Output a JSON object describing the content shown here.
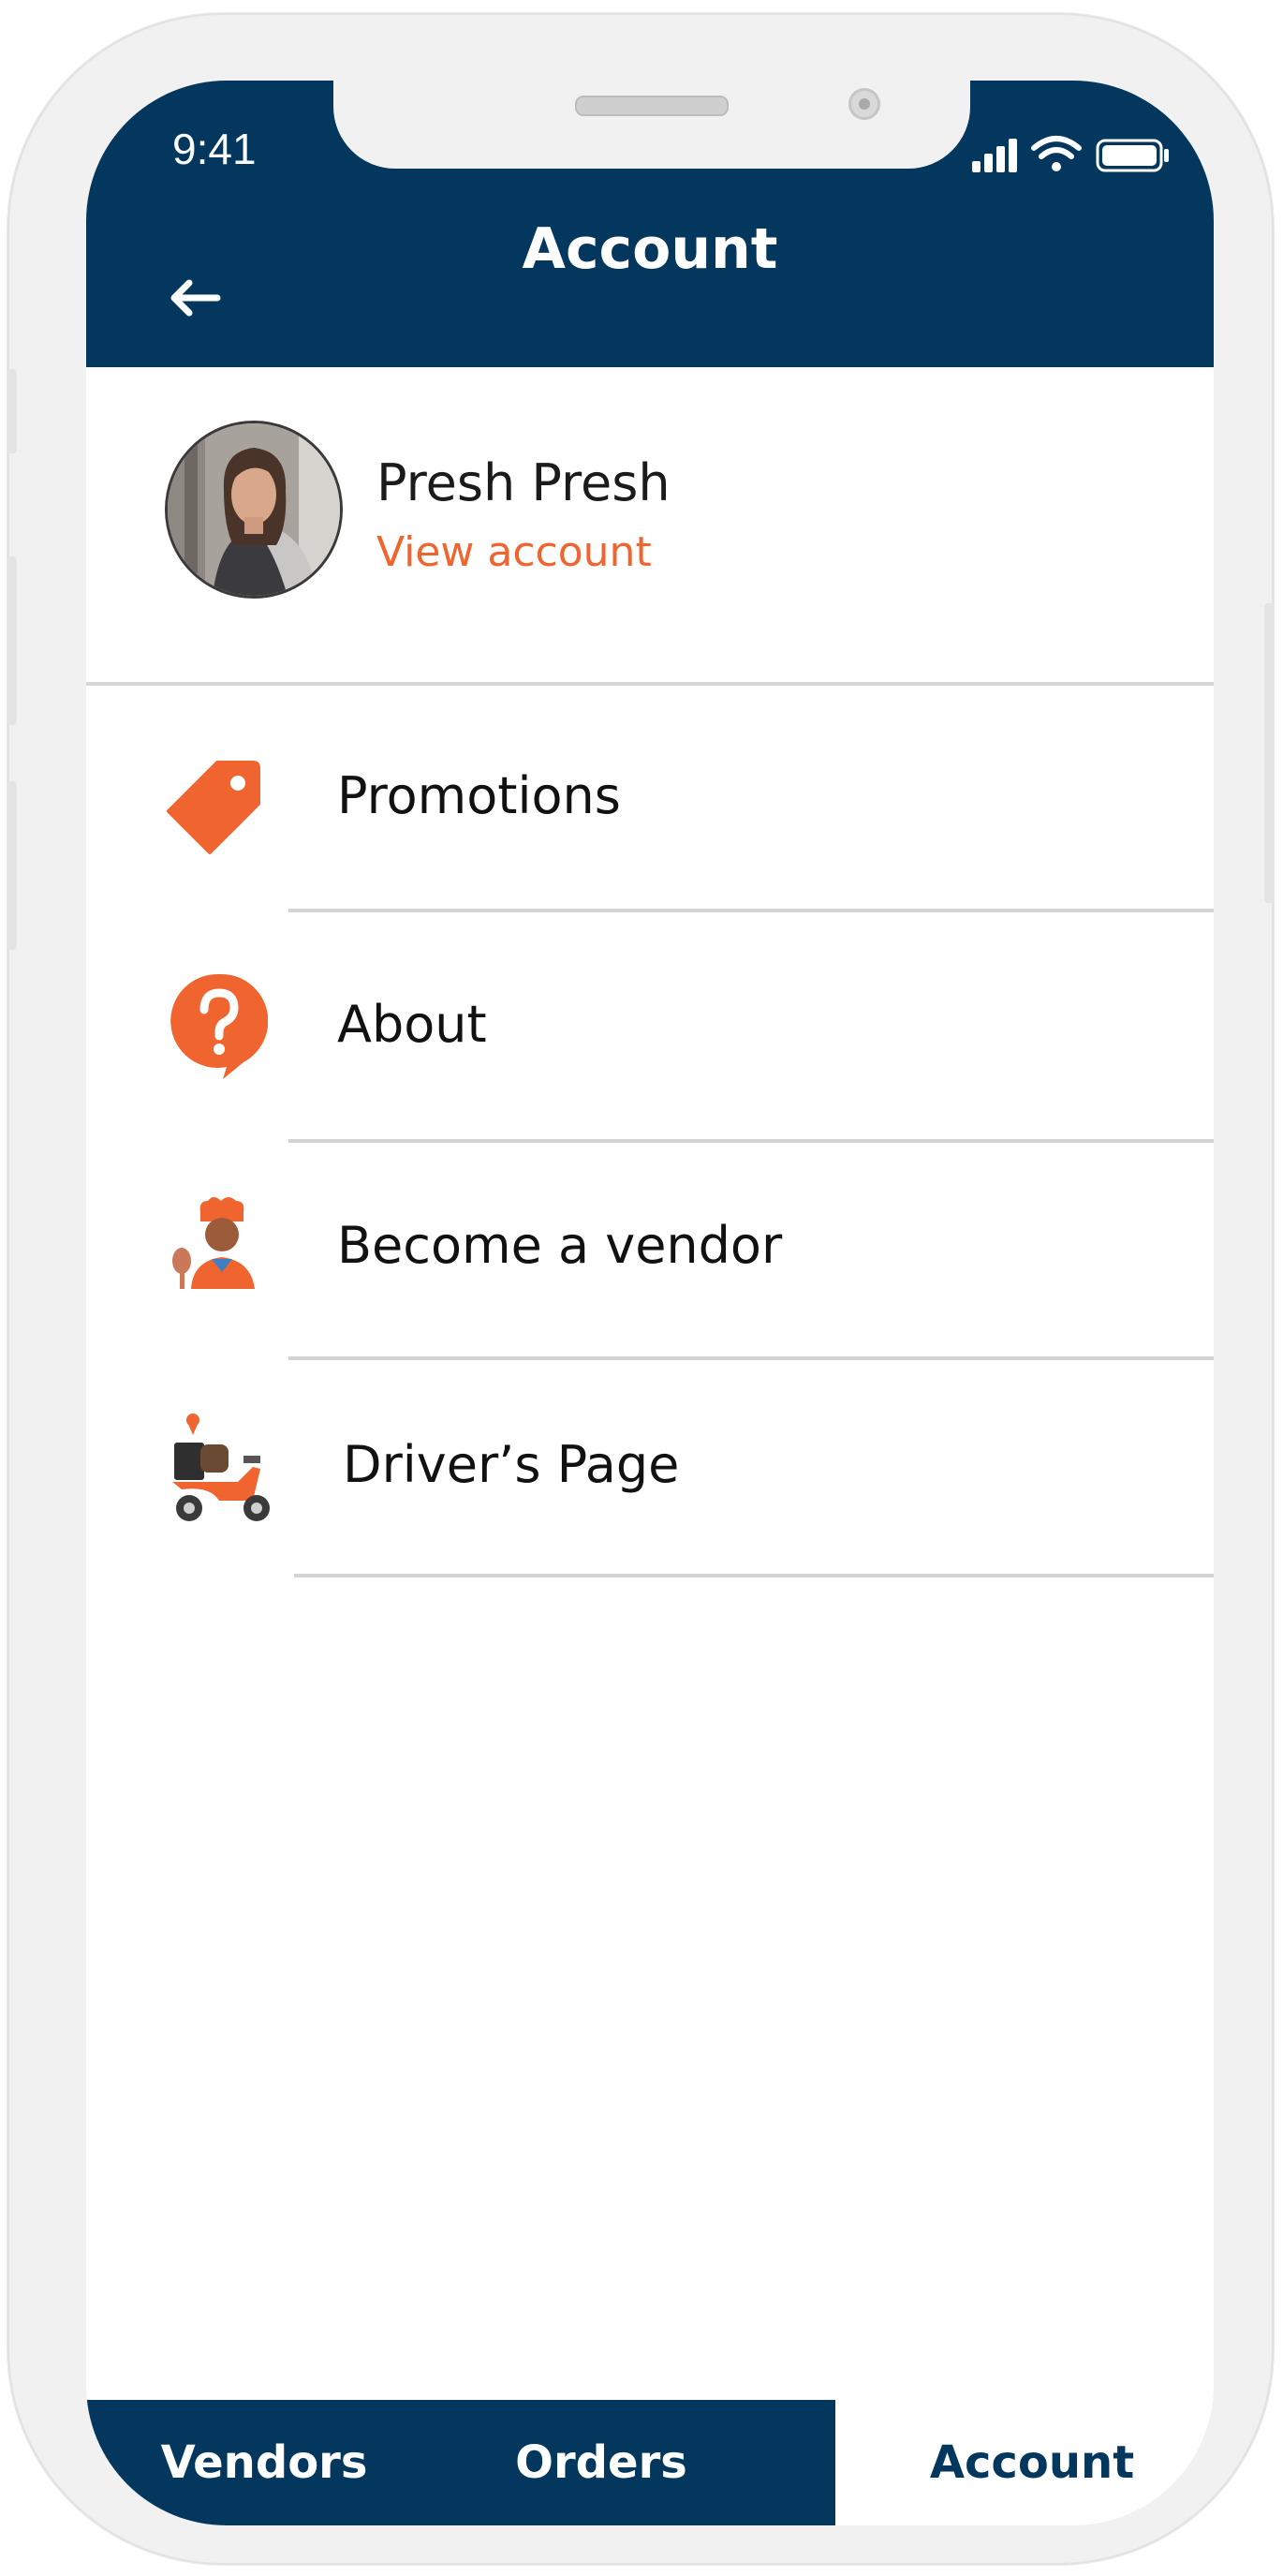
{
  "status_bar": {
    "time": "9:41"
  },
  "header": {
    "title": "Account"
  },
  "profile": {
    "name": "Presh Presh",
    "link": "View account"
  },
  "menu": [
    {
      "label": "Promotions",
      "icon": "tag-icon"
    },
    {
      "label": "About",
      "icon": "question-bubble-icon"
    },
    {
      "label": "Become a vendor",
      "icon": "chef-icon"
    },
    {
      "label": "Driver’s Page",
      "icon": "delivery-scooter-icon"
    }
  ],
  "tabs": [
    {
      "label": "Vendors",
      "active": false
    },
    {
      "label": "Orders",
      "active": false
    },
    {
      "label": "Account",
      "active": true
    }
  ],
  "colors": {
    "primary": "#03375e",
    "accent": "#f0652f",
    "text": "#111111",
    "divider": "#d4d4d4"
  }
}
